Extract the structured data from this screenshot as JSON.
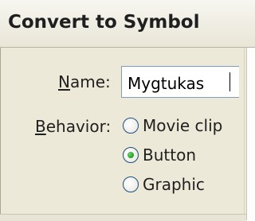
{
  "dialog": {
    "title": "Convert to Symbol"
  },
  "name_field": {
    "label_accel": "N",
    "label_rest": "ame:",
    "value": "Mygtukas"
  },
  "behavior": {
    "label_accel": "B",
    "label_rest": "ehavior:",
    "selected": "Button",
    "options": [
      {
        "label": "Movie clip",
        "checked": false
      },
      {
        "label": "Button",
        "checked": true
      },
      {
        "label": "Graphic",
        "checked": false
      }
    ]
  },
  "colors": {
    "dialog_bg": "#ece9d8",
    "radio_border": "#1c5180",
    "radio_selected_dot": "#21a121",
    "input_border": "#7f9db9"
  }
}
